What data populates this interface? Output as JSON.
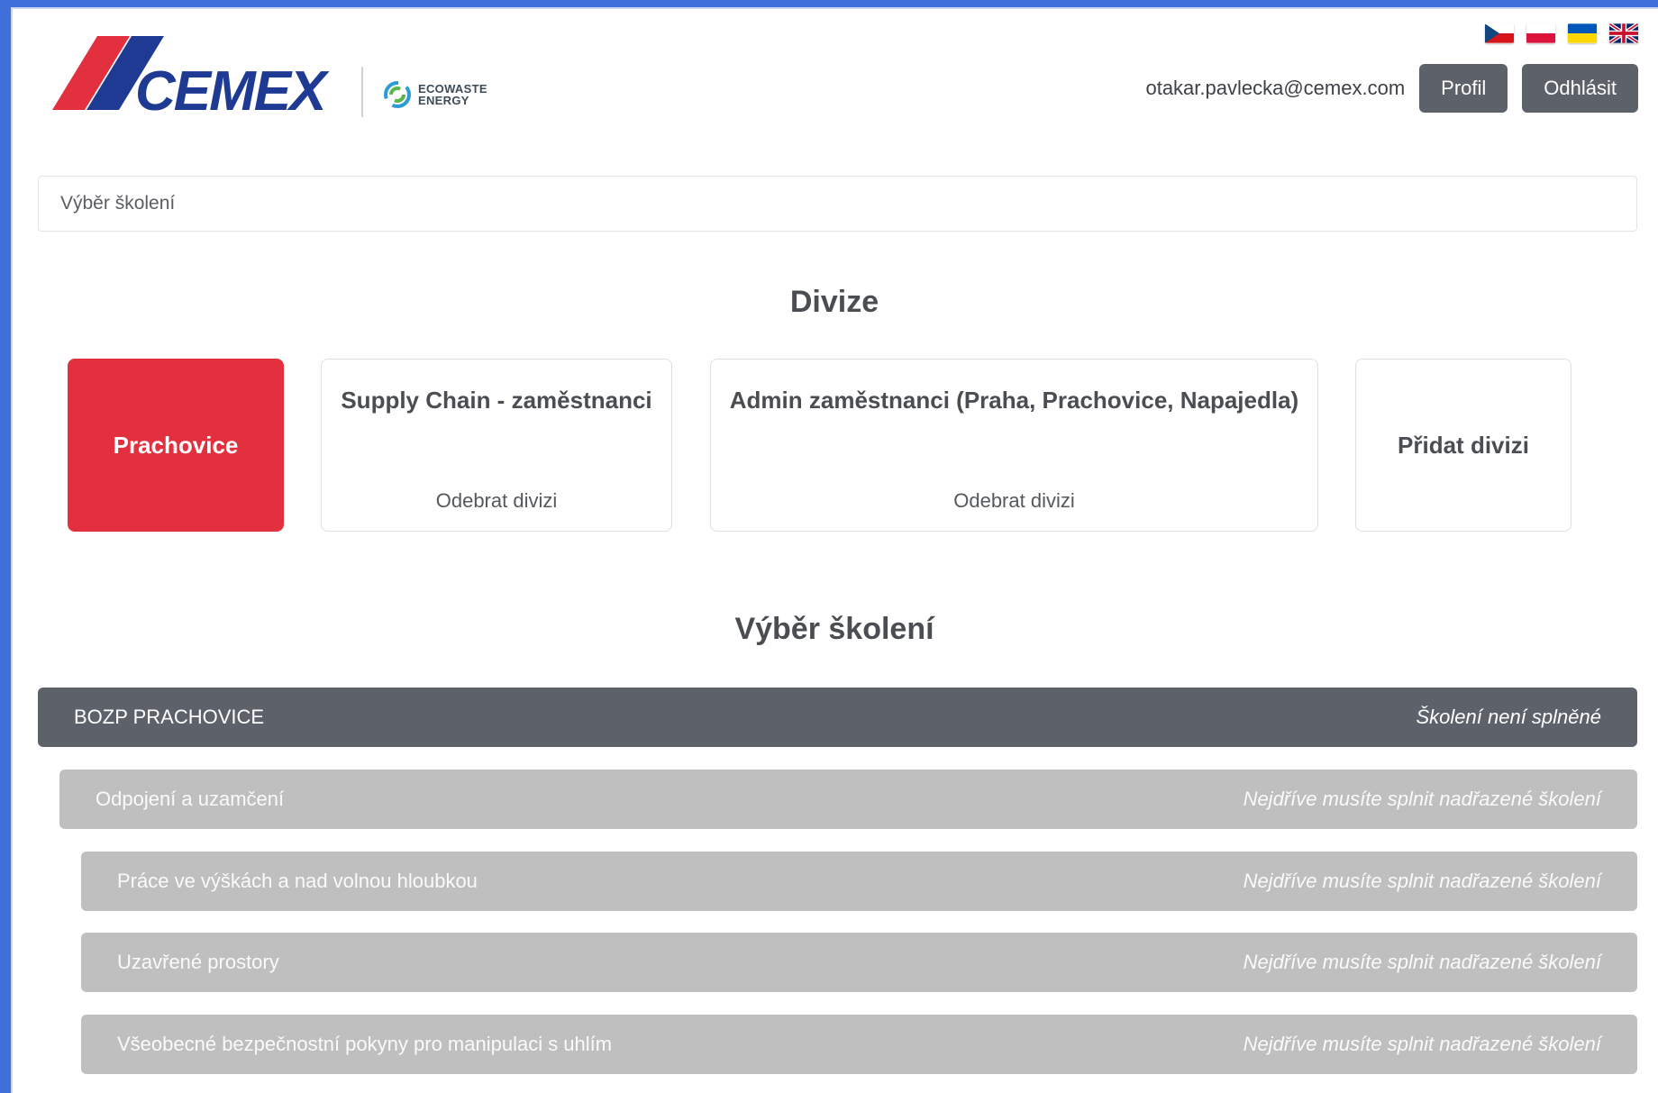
{
  "header": {
    "user_email": "otakar.pavlecka@cemex.com",
    "profile_label": "Profil",
    "logout_label": "Odhlásit",
    "logo_text": "CEMEX",
    "eco_line1": "ECOWASTE",
    "eco_line2": "ENERGY",
    "languages": [
      "cs",
      "pl",
      "uk",
      "en"
    ]
  },
  "search": {
    "placeholder": "Výběr školení"
  },
  "divisions": {
    "title": "Divize",
    "items": [
      {
        "name": "Prachovice",
        "active": true
      },
      {
        "name": "Supply Chain - zaměstnanci",
        "remove_label": "Odebrat divizi"
      },
      {
        "name": "Admin zaměstnanci (Praha, Prachovice, Napajedla)",
        "remove_label": "Odebrat divizi"
      }
    ],
    "add_label": "Přidat divizi"
  },
  "trainings": {
    "title": "Výběr školení",
    "items": [
      {
        "name": "BOZP PRACHOVICE",
        "status": "Školení není splněné"
      },
      {
        "name": "Odpojení a uzamčení",
        "status": "Nejdříve musíte splnit nadřazené školení"
      },
      {
        "name": "Práce ve výškách a nad volnou hloubkou",
        "status": "Nejdříve musíte splnit nadřazené školení"
      },
      {
        "name": "Uzavřené prostory",
        "status": "Nejdříve musíte splnit nadřazené školení"
      },
      {
        "name": "Všeobecné bezpečnostní pokyny pro manipulaci s uhlím",
        "status": "Nejdříve musíte splnit nadřazené školení"
      }
    ]
  },
  "colors": {
    "brand_red": "#e3303e",
    "brand_blue": "#1e3a8a",
    "dark_button": "#5d6169",
    "disabled_row": "#bfbfbf"
  }
}
